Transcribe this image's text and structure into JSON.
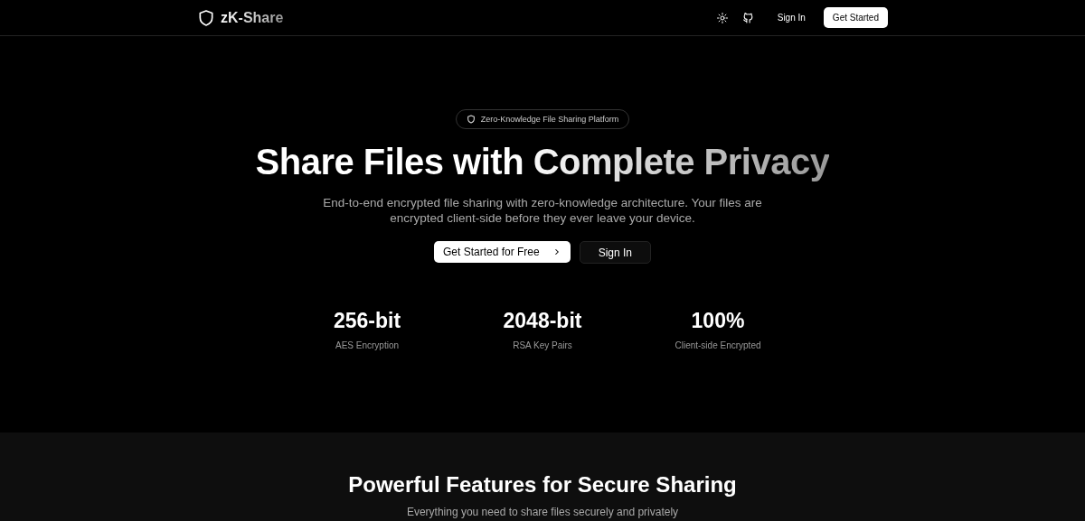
{
  "header": {
    "brand": "zK-Share",
    "sign_in": "Sign In",
    "get_started": "Get Started"
  },
  "hero": {
    "badge": "Zero-Knowledge File Sharing Platform",
    "title": "Share Files with Complete Privacy",
    "description": "End-to-end encrypted file sharing with zero-knowledge architecture. Your files are encrypted client-side before they ever leave your device.",
    "primary_button": "Get Started for Free",
    "secondary_button": "Sign In",
    "stats": [
      {
        "value": "256-bit",
        "label": "AES Encryption"
      },
      {
        "value": "2048-bit",
        "label": "RSA Key Pairs"
      },
      {
        "value": "100%",
        "label": "Client-side Encrypted"
      }
    ]
  },
  "features": {
    "title": "Powerful Features for Secure Sharing",
    "subtitle": "Everything you need to share files securely and privately"
  }
}
